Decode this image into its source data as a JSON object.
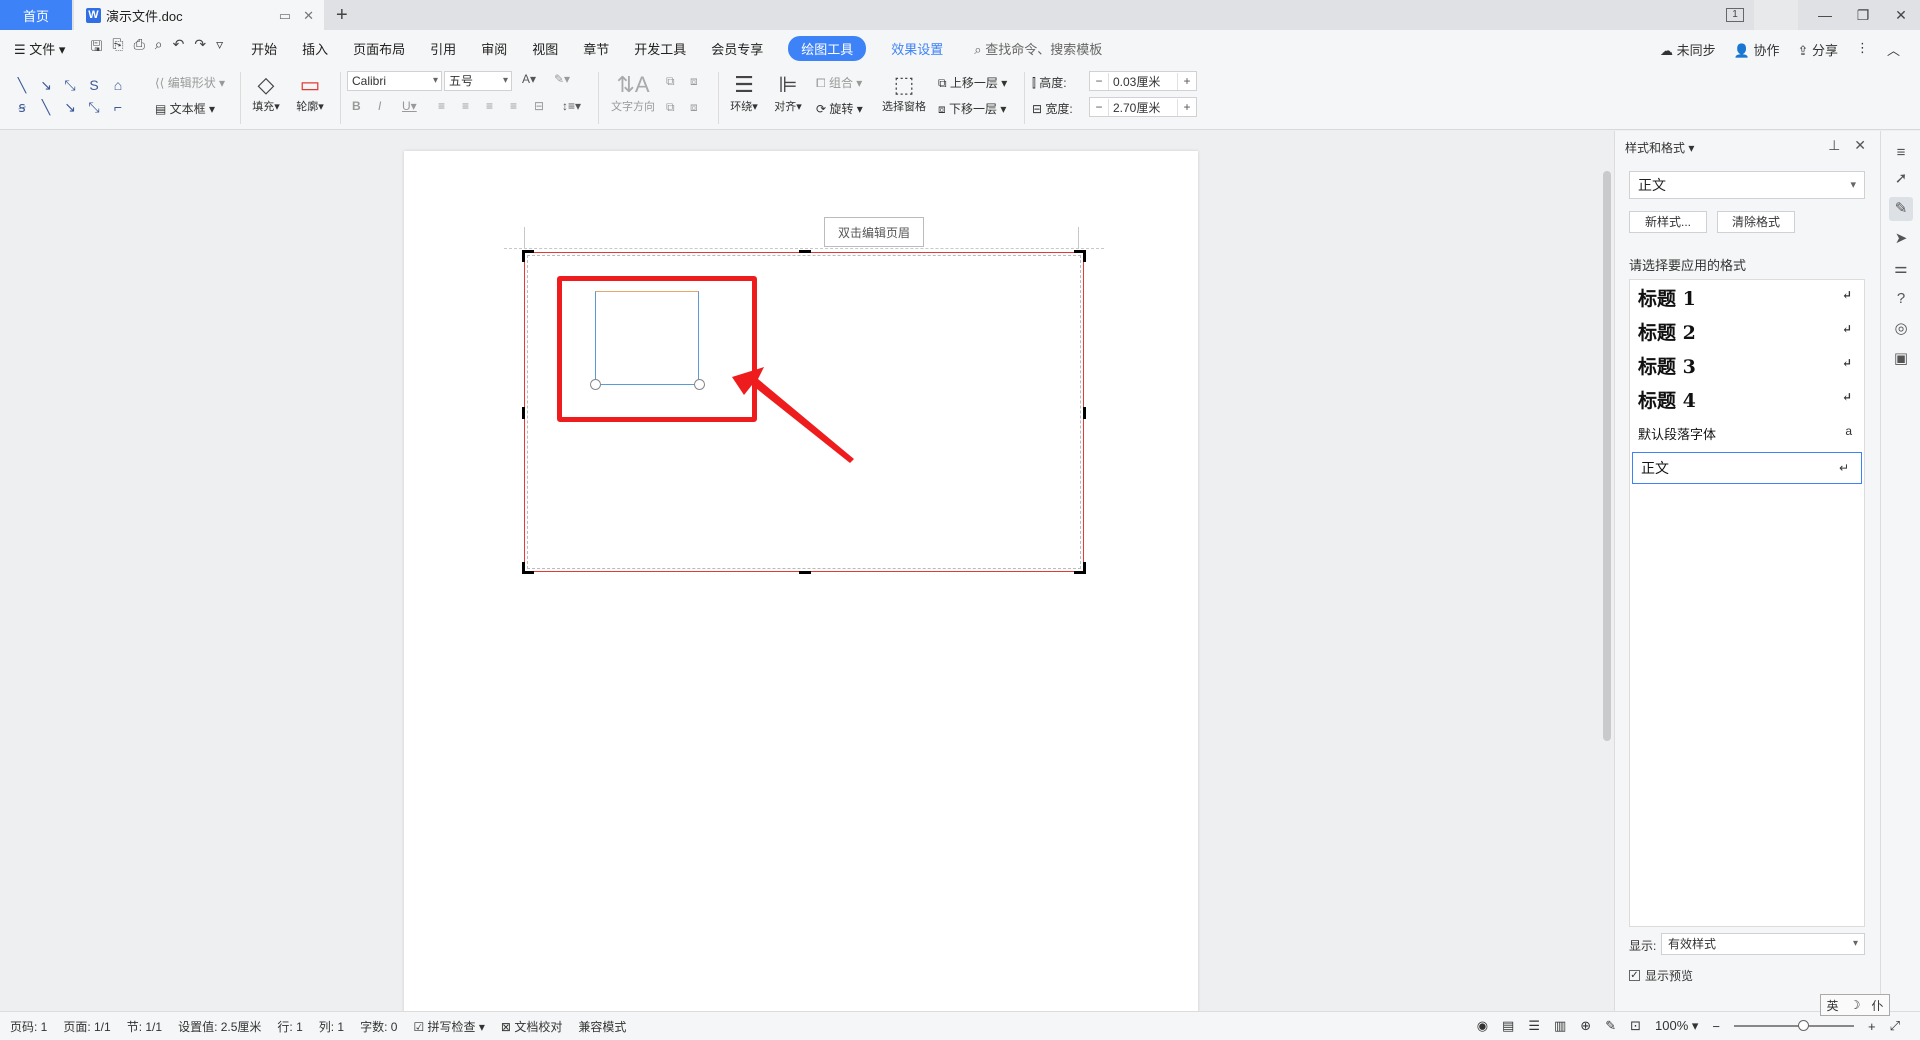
{
  "tabs": {
    "home": "首页",
    "doc_name": "演示文件.doc",
    "doc_icon": "W",
    "new_tab": "+"
  },
  "window": {
    "badge": "1"
  },
  "menu": {
    "file": "文件",
    "items": [
      "开始",
      "插入",
      "页面布局",
      "引用",
      "审阅",
      "视图",
      "章节",
      "开发工具",
      "会员专享"
    ],
    "active": "绘图工具",
    "effects": "效果设置",
    "search": "查找命令、搜索模板",
    "sync": "未同步",
    "collab": "协作",
    "share": "分享"
  },
  "ribbon": {
    "edit_shape": "编辑形状",
    "text_box": "文本框",
    "fill": "填充",
    "outline": "轮廓",
    "font": "Calibri",
    "size": "五号",
    "text_dir": "文字方向",
    "wrap": "环绕",
    "align": "对齐",
    "group": "组合",
    "rotate": "旋转",
    "selection_pane": "选择窗格",
    "bring_forward": "上移一层",
    "send_backward": "下移一层",
    "height_label": "高度:",
    "height_value": "0.03厘米",
    "width_label": "宽度:",
    "width_value": "2.70厘米"
  },
  "document": {
    "header_tag": "双击编辑页眉"
  },
  "panel": {
    "title": "样式和格式",
    "current_style": "正文",
    "new_style": "新样式...",
    "clear_format": "清除格式",
    "hint": "请选择要应用的格式",
    "styles": [
      "标题  1",
      "标题  2",
      "标题  3",
      "标题  4",
      "默认段落字体",
      "正文"
    ],
    "show_label": "显示:",
    "show_value": "有效样式",
    "preview_label": "显示预览"
  },
  "status": {
    "page_num": "页码: 1",
    "pages": "页面: 1/1",
    "section": "节: 1/1",
    "setting": "设置值: 2.5厘米",
    "row": "行: 1",
    "col": "列: 1",
    "words": "字数: 0",
    "spell": "拼写检查",
    "proof": "文档校对",
    "compat": "兼容模式",
    "zoom": "100%"
  },
  "ime": {
    "lang": "英",
    "moon": "☽",
    "punct": "仆"
  },
  "colors": {
    "accent": "#3d82f7",
    "annotation_red": "#ee1c1c"
  }
}
